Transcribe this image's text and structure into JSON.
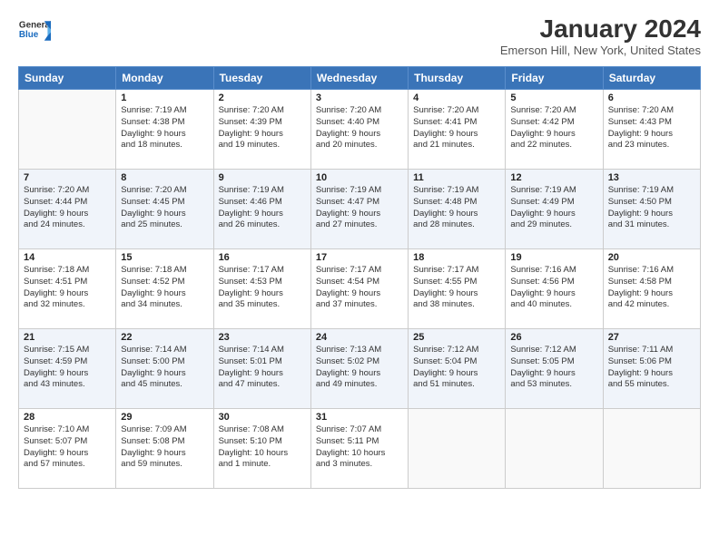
{
  "logo": {
    "line1": "General",
    "line2": "Blue"
  },
  "title": "January 2024",
  "location": "Emerson Hill, New York, United States",
  "days_header": [
    "Sunday",
    "Monday",
    "Tuesday",
    "Wednesday",
    "Thursday",
    "Friday",
    "Saturday"
  ],
  "weeks": [
    [
      {
        "day": "",
        "info": ""
      },
      {
        "day": "1",
        "info": "Sunrise: 7:19 AM\nSunset: 4:38 PM\nDaylight: 9 hours\nand 18 minutes."
      },
      {
        "day": "2",
        "info": "Sunrise: 7:20 AM\nSunset: 4:39 PM\nDaylight: 9 hours\nand 19 minutes."
      },
      {
        "day": "3",
        "info": "Sunrise: 7:20 AM\nSunset: 4:40 PM\nDaylight: 9 hours\nand 20 minutes."
      },
      {
        "day": "4",
        "info": "Sunrise: 7:20 AM\nSunset: 4:41 PM\nDaylight: 9 hours\nand 21 minutes."
      },
      {
        "day": "5",
        "info": "Sunrise: 7:20 AM\nSunset: 4:42 PM\nDaylight: 9 hours\nand 22 minutes."
      },
      {
        "day": "6",
        "info": "Sunrise: 7:20 AM\nSunset: 4:43 PM\nDaylight: 9 hours\nand 23 minutes."
      }
    ],
    [
      {
        "day": "7",
        "info": "Sunrise: 7:20 AM\nSunset: 4:44 PM\nDaylight: 9 hours\nand 24 minutes."
      },
      {
        "day": "8",
        "info": "Sunrise: 7:20 AM\nSunset: 4:45 PM\nDaylight: 9 hours\nand 25 minutes."
      },
      {
        "day": "9",
        "info": "Sunrise: 7:19 AM\nSunset: 4:46 PM\nDaylight: 9 hours\nand 26 minutes."
      },
      {
        "day": "10",
        "info": "Sunrise: 7:19 AM\nSunset: 4:47 PM\nDaylight: 9 hours\nand 27 minutes."
      },
      {
        "day": "11",
        "info": "Sunrise: 7:19 AM\nSunset: 4:48 PM\nDaylight: 9 hours\nand 28 minutes."
      },
      {
        "day": "12",
        "info": "Sunrise: 7:19 AM\nSunset: 4:49 PM\nDaylight: 9 hours\nand 29 minutes."
      },
      {
        "day": "13",
        "info": "Sunrise: 7:19 AM\nSunset: 4:50 PM\nDaylight: 9 hours\nand 31 minutes."
      }
    ],
    [
      {
        "day": "14",
        "info": "Sunrise: 7:18 AM\nSunset: 4:51 PM\nDaylight: 9 hours\nand 32 minutes."
      },
      {
        "day": "15",
        "info": "Sunrise: 7:18 AM\nSunset: 4:52 PM\nDaylight: 9 hours\nand 34 minutes."
      },
      {
        "day": "16",
        "info": "Sunrise: 7:17 AM\nSunset: 4:53 PM\nDaylight: 9 hours\nand 35 minutes."
      },
      {
        "day": "17",
        "info": "Sunrise: 7:17 AM\nSunset: 4:54 PM\nDaylight: 9 hours\nand 37 minutes."
      },
      {
        "day": "18",
        "info": "Sunrise: 7:17 AM\nSunset: 4:55 PM\nDaylight: 9 hours\nand 38 minutes."
      },
      {
        "day": "19",
        "info": "Sunrise: 7:16 AM\nSunset: 4:56 PM\nDaylight: 9 hours\nand 40 minutes."
      },
      {
        "day": "20",
        "info": "Sunrise: 7:16 AM\nSunset: 4:58 PM\nDaylight: 9 hours\nand 42 minutes."
      }
    ],
    [
      {
        "day": "21",
        "info": "Sunrise: 7:15 AM\nSunset: 4:59 PM\nDaylight: 9 hours\nand 43 minutes."
      },
      {
        "day": "22",
        "info": "Sunrise: 7:14 AM\nSunset: 5:00 PM\nDaylight: 9 hours\nand 45 minutes."
      },
      {
        "day": "23",
        "info": "Sunrise: 7:14 AM\nSunset: 5:01 PM\nDaylight: 9 hours\nand 47 minutes."
      },
      {
        "day": "24",
        "info": "Sunrise: 7:13 AM\nSunset: 5:02 PM\nDaylight: 9 hours\nand 49 minutes."
      },
      {
        "day": "25",
        "info": "Sunrise: 7:12 AM\nSunset: 5:04 PM\nDaylight: 9 hours\nand 51 minutes."
      },
      {
        "day": "26",
        "info": "Sunrise: 7:12 AM\nSunset: 5:05 PM\nDaylight: 9 hours\nand 53 minutes."
      },
      {
        "day": "27",
        "info": "Sunrise: 7:11 AM\nSunset: 5:06 PM\nDaylight: 9 hours\nand 55 minutes."
      }
    ],
    [
      {
        "day": "28",
        "info": "Sunrise: 7:10 AM\nSunset: 5:07 PM\nDaylight: 9 hours\nand 57 minutes."
      },
      {
        "day": "29",
        "info": "Sunrise: 7:09 AM\nSunset: 5:08 PM\nDaylight: 9 hours\nand 59 minutes."
      },
      {
        "day": "30",
        "info": "Sunrise: 7:08 AM\nSunset: 5:10 PM\nDaylight: 10 hours\nand 1 minute."
      },
      {
        "day": "31",
        "info": "Sunrise: 7:07 AM\nSunset: 5:11 PM\nDaylight: 10 hours\nand 3 minutes."
      },
      {
        "day": "",
        "info": ""
      },
      {
        "day": "",
        "info": ""
      },
      {
        "day": "",
        "info": ""
      }
    ]
  ]
}
